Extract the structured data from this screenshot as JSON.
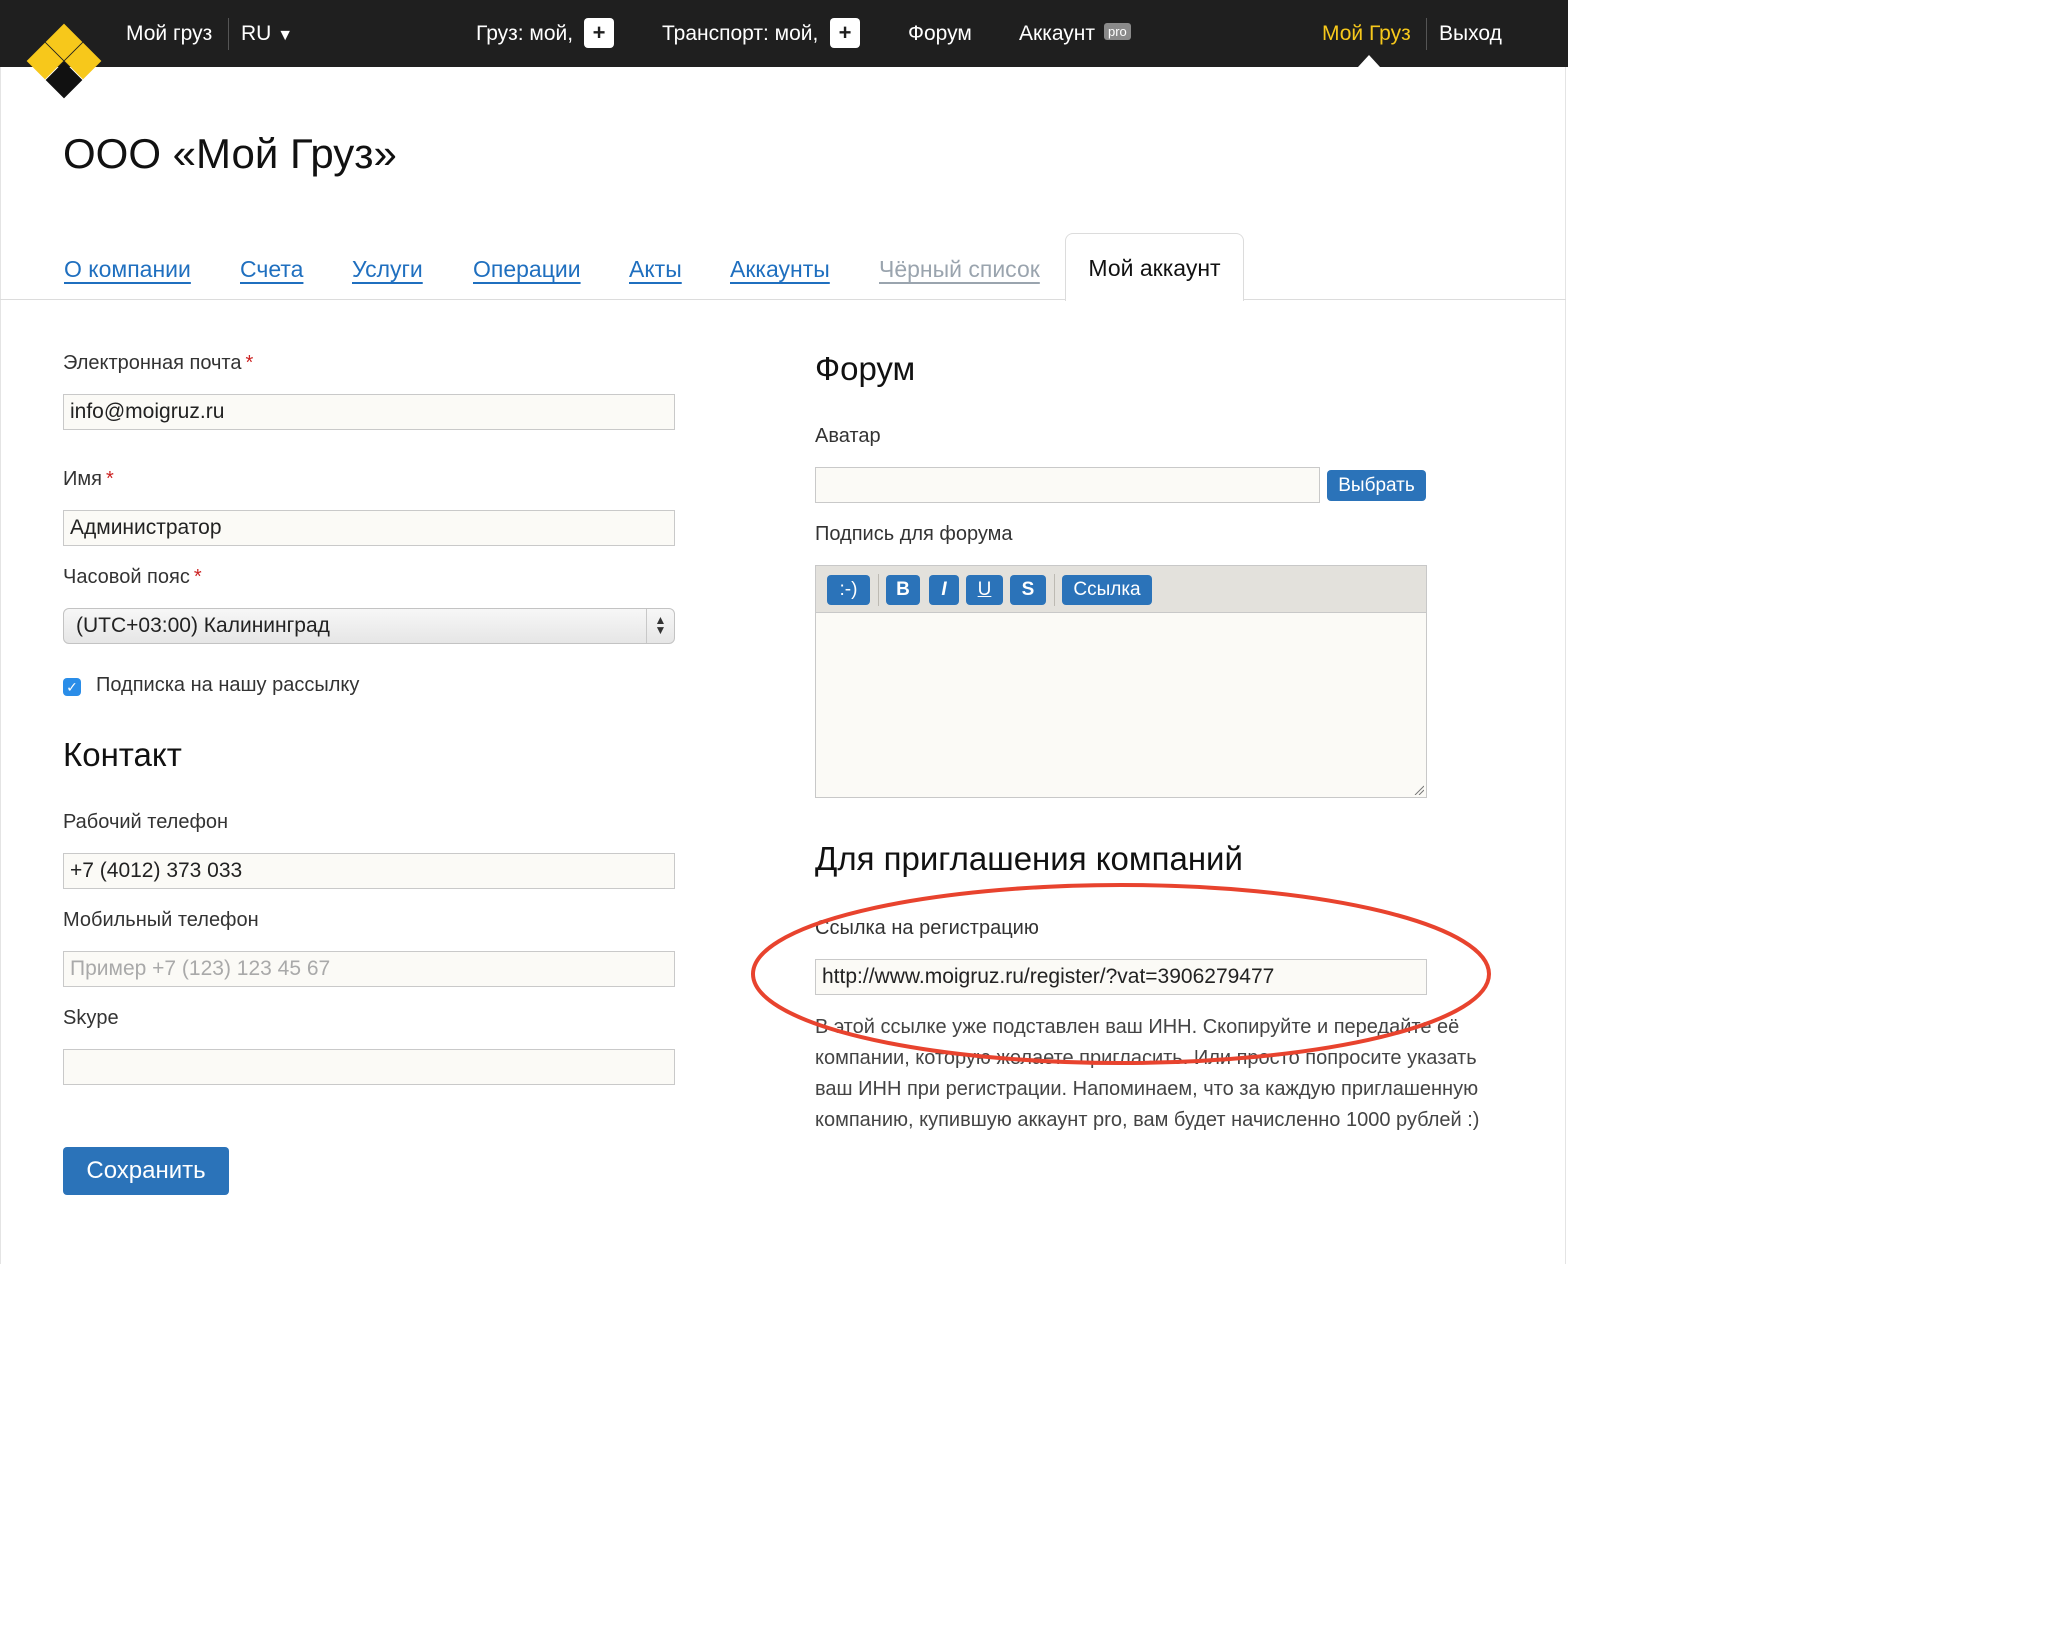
{
  "topnav": {
    "my_cargo": "Мой груз",
    "lang": "RU",
    "cargo_mine": "Груз: мой,",
    "transport_mine": "Транспорт: мой,",
    "plus": "+",
    "forum": "Форум",
    "account": "Аккаунт",
    "pro": "pro",
    "my_cargo_active": "Мой Груз",
    "logout": "Выход"
  },
  "page": {
    "title": "ООО «Мой Груз»"
  },
  "tabs": {
    "about": "О компании",
    "invoices": "Счета",
    "services": "Услуги",
    "operations": "Операции",
    "acts": "Акты",
    "accounts": "Аккаунты",
    "blacklist": "Чёрный список",
    "my_account": "Мой аккаунт"
  },
  "form": {
    "email_label": "Электронная почта",
    "email_value": "info@moigruz.ru",
    "name_label": "Имя",
    "name_value": "Администратор",
    "timezone_label": "Часовой пояс",
    "timezone_value": "(UTC+03:00) Калининград",
    "subscribe_label": "Подписка на нашу рассылку",
    "required_mark": "*"
  },
  "contact": {
    "title": "Контакт",
    "work_phone_label": "Рабочий телефон",
    "work_phone_value": "+7 (4012) 373 033",
    "mobile_label": "Мобильный телефон",
    "mobile_placeholder": "Пример +7 (123) 123 45 67",
    "skype_label": "Skype",
    "save": "Сохранить"
  },
  "forum": {
    "title": "Форум",
    "avatar_label": "Аватар",
    "choose": "Выбрать",
    "signature_label": "Подпись для форума",
    "toolbar": {
      "smile": ":-)",
      "bold": "B",
      "italic": "I",
      "underline": "U",
      "strike": "S",
      "link": "Ссылка"
    }
  },
  "invite": {
    "title": "Для приглашения компаний",
    "link_label": "Ссылка на регистрацию",
    "link_value": "http://www.moigruz.ru/register/?vat=3906279477",
    "note": "В этой ссылке уже подставлен ваш ИНН. Скопируйте и передайте её компании, которую желаете пригласить. Или просто попросите указать ваш ИНН при регистрации. Напоминаем, что за каждую приглашенную компанию, купившую аккаунт pro, вам будет начисленно 1000 рублей :)"
  },
  "colors": {
    "accent": "#2b73b9",
    "logo_yellow": "#f7c81b",
    "topbar": "#1f1f1f",
    "annotation": "#e8432e"
  }
}
